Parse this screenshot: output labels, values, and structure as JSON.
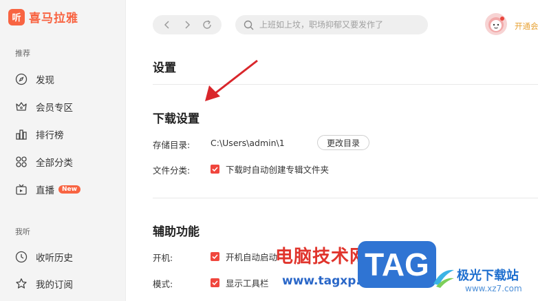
{
  "app": {
    "logo_glyph": "听",
    "name": "喜马拉雅"
  },
  "sidebar": {
    "section_recommend": "推荐",
    "section_mine": "我听",
    "items": [
      {
        "label": "发现",
        "icon": "compass-icon"
      },
      {
        "label": "会员专区",
        "icon": "crown-icon"
      },
      {
        "label": "排行榜",
        "icon": "ranking-icon"
      },
      {
        "label": "全部分类",
        "icon": "grid-icon"
      },
      {
        "label": "直播",
        "icon": "tv-icon",
        "badge": "New"
      },
      {
        "label": "收听历史",
        "icon": "clock-icon"
      },
      {
        "label": "我的订阅",
        "icon": "star-icon"
      }
    ]
  },
  "topbar": {
    "search_placeholder": "上班如上坟，职场抑郁又要发作了",
    "vip_link": "开通会"
  },
  "settings": {
    "page_title": "设置",
    "download": {
      "title": "下载设置",
      "storage_label": "存储目录:",
      "storage_path": "C:\\Users\\admin\\1",
      "change_dir_button": "更改目录",
      "category_label": "文件分类:",
      "category_checkbox": "下载时自动创建专辑文件夹"
    },
    "accessibility": {
      "title": "辅助功能",
      "startup_label": "开机:",
      "startup_checkbox": "开机自动启动",
      "mode_label": "模式:",
      "mode_checkbox": "显示工具栏"
    }
  },
  "watermark": {
    "cn_title": "电脑技术网",
    "url": "www.tagxp.com",
    "tag": "TAG",
    "site_cn": "极光下载站",
    "site_url": "www.xz7.com"
  },
  "colors": {
    "brand": "#f86442",
    "checkbox": "#f0463d",
    "vip": "#e8a234",
    "annotation_arrow": "#d9262b"
  }
}
